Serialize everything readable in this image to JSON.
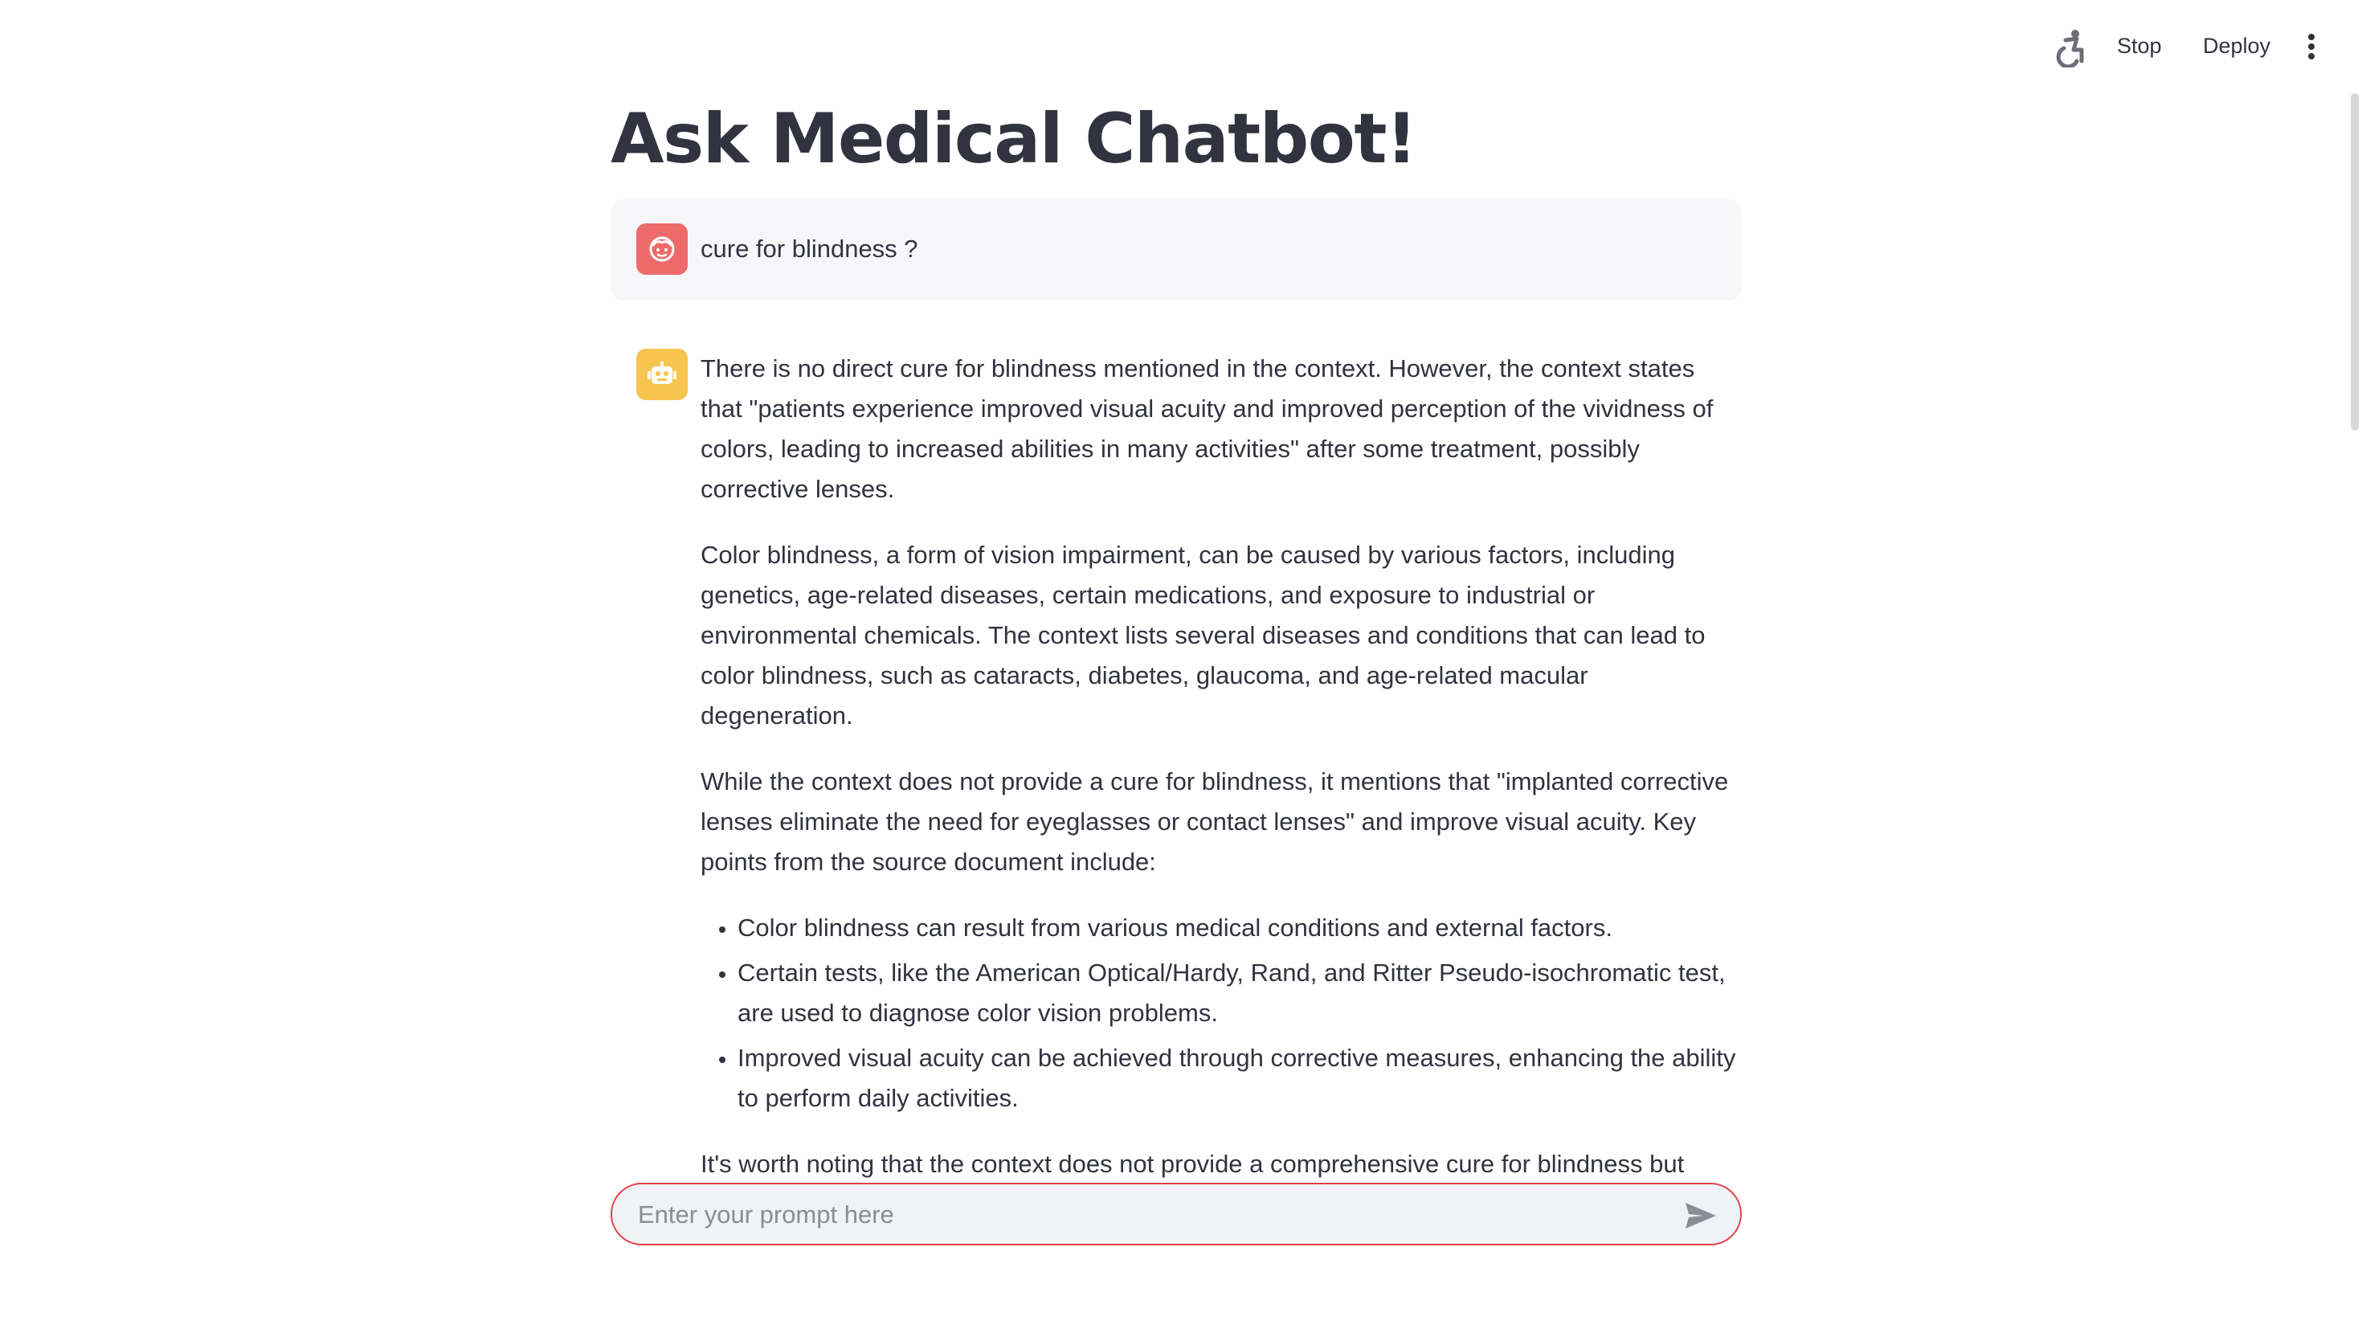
{
  "toolbar": {
    "running_icon": "running-person-icon",
    "stop_label": "Stop",
    "deploy_label": "Deploy",
    "menu_icon": "vertical-dots-icon"
  },
  "page": {
    "title": "Ask Medical Chatbot!"
  },
  "messages": {
    "user": {
      "avatar_icon": "face-icon",
      "avatar_color": "#ee6b6b",
      "text": "cure for blindness ?"
    },
    "assistant": {
      "avatar_icon": "robot-icon",
      "avatar_color": "#f6c44f",
      "paragraph_1": "There is no direct cure for blindness mentioned in the context. However, the context states that \"patients experience improved visual acuity and improved perception of the vividness of colors, leading to increased abilities in many activities\" after some treatment, possibly corrective lenses.",
      "paragraph_2": "Color blindness, a form of vision impairment, can be caused by various factors, including genetics, age-related diseases, certain medications, and exposure to industrial or environmental chemicals. The context lists several diseases and conditions that can lead to color blindness, such as cataracts, diabetes, glaucoma, and age-related macular degeneration.",
      "paragraph_3": "While the context does not provide a cure for blindness, it mentions that \"implanted corrective lenses eliminate the need for eyeglasses or contact lenses\" and improve visual acuity. Key points from the source document include:",
      "bullets": [
        "Color blindness can result from various medical conditions and external factors.",
        "Certain tests, like the American Optical/Hardy, Rand, and Ritter Pseudo-isochromatic test, are used to diagnose color vision problems.",
        "Improved visual acuity can be achieved through corrective measures, enhancing the ability to perform daily activities."
      ],
      "paragraph_4": "It's worth noting that the context does not provide a comprehensive cure for blindness but highlights potential improvements through corrective measures."
    }
  },
  "chat_input": {
    "placeholder": "Enter your prompt here",
    "value": "",
    "send_icon": "send-icon",
    "border_color": "#e0424a"
  }
}
